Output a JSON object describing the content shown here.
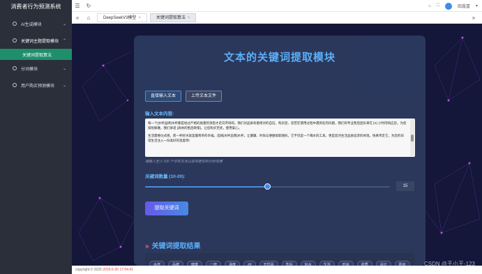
{
  "app": {
    "title": "消费者行为预测系统"
  },
  "sidebar": {
    "items": [
      {
        "label": "AI生成模块"
      },
      {
        "label": "关键词主题提取模块"
      },
      {
        "label": "关键词提取算法"
      },
      {
        "label": "分词模块"
      },
      {
        "label": "用户购买预测模块"
      }
    ]
  },
  "topbar": {
    "user_name": "田鑫富"
  },
  "tabs": [
    {
      "label": "DeepSeekV3模型"
    },
    {
      "label": "关键词提取算法"
    }
  ],
  "panel": {
    "title": "文本的关键词提取模块",
    "input_tab_direct": "直接输入文本",
    "input_tab_upload": "上传文本文件",
    "input_label": "输入文本内容:",
    "text_para1": "每一个[水杯品牌]水杯都是经过严格的质量检测后才走向市场的。我们对品质有着绝对的自信。购买后，您若在使用过程中遇到任何问题，我们的专业售后团队将在 [X] 小时内响应您，为您排忧解难。我们承诺 [具体的售后政策]，让您购买无忧，使用安心。",
    "text_para2": "生活需要仪式感，而一杯好水就是最简单的幸福。选择[水杯品牌]水杯，让健康、时尚与便捷如影随形。它不仅是一个喝水的工具，更是您对生活品质追求的体现。快来带走它，为您的日常生活注入一份美好的温度吧!",
    "hint": "请输入至少 100 个字的文本以获得更好的分析效果",
    "keyword_count_label": "关键词数量 (10-20):",
    "keyword_count_value": "15",
    "keyword_count_fraction": 0.5,
    "extract_button": "提取关键词",
    "result_title": "关键词提取结果",
    "keywords": [
      "水杯",
      "品牌",
      "健康",
      "一杯",
      "温度",
      "##",
      "无忧是",
      "售后",
      "好水",
      "生活",
      "时尚",
      "材质",
      "设计",
      "购买"
    ]
  },
  "footer": {
    "copyright": "copyright © 2025",
    "datetime": "2025-5-20 17:04:41"
  },
  "watermark": "CSDN @王小王-123",
  "colors": {
    "sidebar_bg": "#2b2f3a",
    "active_menu": "#1f8f6b",
    "main_bg": "#14163a",
    "panel_bg": "#2c3a5e",
    "title_blue": "#5fb4ff"
  }
}
